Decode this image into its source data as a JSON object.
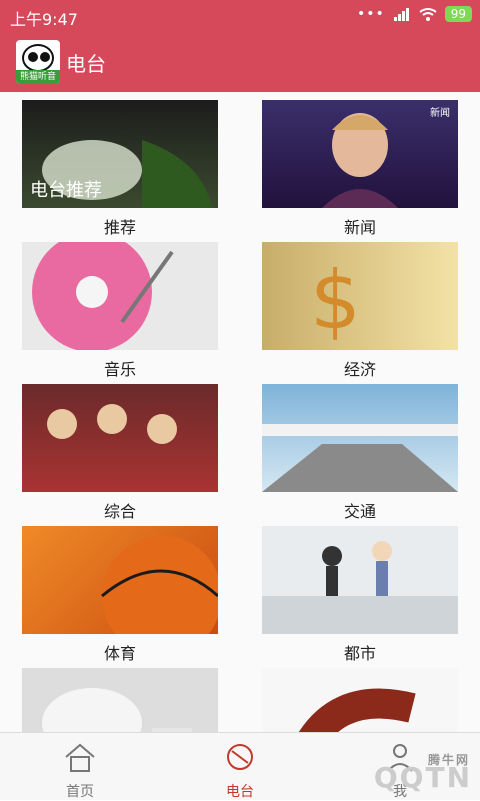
{
  "status": {
    "time": "上午9:47",
    "battery": "99"
  },
  "appbar": {
    "logo_text": "熊猫听音",
    "title": "电台"
  },
  "grid": [
    {
      "label": "推荐",
      "overlay": "电台推荐",
      "scene": "moon"
    },
    {
      "label": "新闻",
      "overlay": "新闻",
      "scene": "news"
    },
    {
      "label": "音乐",
      "scene": "vinyl"
    },
    {
      "label": "经济",
      "scene": "dollar"
    },
    {
      "label": "综合",
      "scene": "crowd"
    },
    {
      "label": "交通",
      "scene": "highway"
    },
    {
      "label": "体育",
      "scene": "basketball"
    },
    {
      "label": "都市",
      "scene": "city"
    },
    {
      "label": "",
      "scene": "tea"
    },
    {
      "label": "",
      "scene": "violin"
    }
  ],
  "tabs": [
    {
      "label": "首页",
      "icon": "home-icon"
    },
    {
      "label": "电台",
      "icon": "radio-icon"
    },
    {
      "label": "我",
      "icon": "user-icon"
    }
  ],
  "watermark": {
    "brand": "QQTN",
    "small": "腾牛网"
  }
}
